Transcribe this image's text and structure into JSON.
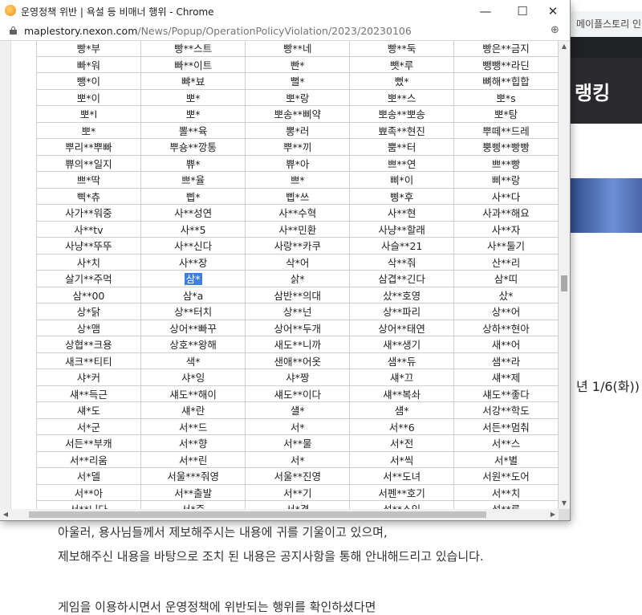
{
  "background": {
    "tab_title": "메이플스토리 인",
    "heading": "랭킹",
    "date_text": "년 1/6(화))",
    "lines": [
      "아울러, 용사님들께서 제보해주시는 내용에 귀를 기울이고 있으며,",
      "제보해주신 내용을 바탕으로 조치 된 내용은 공지사항을 통해 안내해드리고 있습니다.",
      "게임을 이용하시면서 운영정책에 위반되는 행위를 확인하셨다면"
    ]
  },
  "window": {
    "title": "운영정책 위반 | 욕설 등 비매너 행위 - Chrome",
    "minimize": "—",
    "maximize": "☐",
    "close": "✕",
    "url_host": "maplestory.nexon.com",
    "url_path": "/News/Popup/OperationPolicyViolation/2023/20230106"
  },
  "table": {
    "selected": "삼*",
    "rows": [
      [
        "빵*부",
        "빵**스트",
        "빵**네",
        "빵**둑",
        "빵은**금지"
      ],
      [
        "빠*워",
        "빠**이트",
        "빤*",
        "뺏*루",
        "뺑뺑**라딘"
      ],
      [
        "뺑*이",
        "뺘*뵤",
        "뻘*",
        "뻤*",
        "뼈해**힙합"
      ],
      [
        "뽀*이",
        "뽀*",
        "뽀*랑",
        "뽀**스",
        "뽀*s"
      ],
      [
        "뽀*l",
        "뽀*",
        "뽀송**삐약",
        "뽀송**뽀송",
        "뽀*탕"
      ],
      [
        "뽀*",
        "뽈**육",
        "뽕*러",
        "뾰족**현진",
        "뿌떼**드레"
      ],
      [
        "뿌리**뿌빠",
        "뿌숑**깡통",
        "뿌**끼",
        "뿜**터",
        "뿡삥**빵빵"
      ],
      [
        "쀼의**일지",
        "쀼*",
        "쀼*아",
        "쁘**연",
        "쁘**빵"
      ],
      [
        "쁘*딱",
        "쁘*율",
        "쁘*",
        "삐*이",
        "삐**랑"
      ],
      [
        "삑*츄",
        "삡*",
        "삡*쓰",
        "삥*후",
        "사**다"
      ],
      [
        "사가**워중",
        "사**성연",
        "사**수혁",
        "사**현",
        "사과**해요"
      ],
      [
        "사**tv",
        "사**5",
        "사**민환",
        "사냥**할래",
        "사**자"
      ],
      [
        "사냥**뚜뚜",
        "사**신다",
        "사랑**카쿠",
        "사슬**21",
        "사**둘기"
      ],
      [
        "사*치",
        "사**장",
        "삭*어",
        "삭**줘",
        "산**리"
      ],
      [
        "살기**주먹",
        "",
        "삵*",
        "삼겹**긴다",
        "삼*띠"
      ],
      [
        "삼**00",
        "삼*a",
        "삼반**의대",
        "샀**호영",
        "샀*"
      ],
      [
        "상*닭",
        "상**터치",
        "상**넌",
        "상**파리",
        "상**어"
      ],
      [
        "상*맴",
        "상어**빠꾸",
        "상어**두개",
        "상어**태연",
        "상하**현아"
      ],
      [
        "상협**크용",
        "상호**왕해",
        "새도**니까",
        "새**생기",
        "새**어"
      ],
      [
        "새크**티티",
        "색*",
        "샌애**어옷",
        "샘**듀",
        "샘**라"
      ],
      [
        "샤*커",
        "샤*잉",
        "샤*짱",
        "섀*끄",
        "섀**제"
      ],
      [
        "섀**득근",
        "섀도**해이",
        "섀도**이다",
        "섀**복솨",
        "섀도**좋다"
      ],
      [
        "섀*도",
        "섀*란",
        "섈*",
        "섐*",
        "서강**학도"
      ],
      [
        "서*군",
        "서**드",
        "서*",
        "서**6",
        "서든**멈춰"
      ],
      [
        "서든**부캐",
        "서**향",
        "서**물",
        "서*전",
        "서**스"
      ],
      [
        "서**리움",
        "서**린",
        "서*",
        "서*씩",
        "서*별"
      ],
      [
        "서*델",
        "서울***줘영",
        "서울**진영",
        "서**도녀",
        "서원**도어"
      ],
      [
        "서**아",
        "서**출발",
        "서**기",
        "서펜**호기",
        "서**치"
      ],
      [
        "서**니다",
        "서*준",
        "서*겸",
        "석**소인",
        "석**루"
      ]
    ]
  }
}
